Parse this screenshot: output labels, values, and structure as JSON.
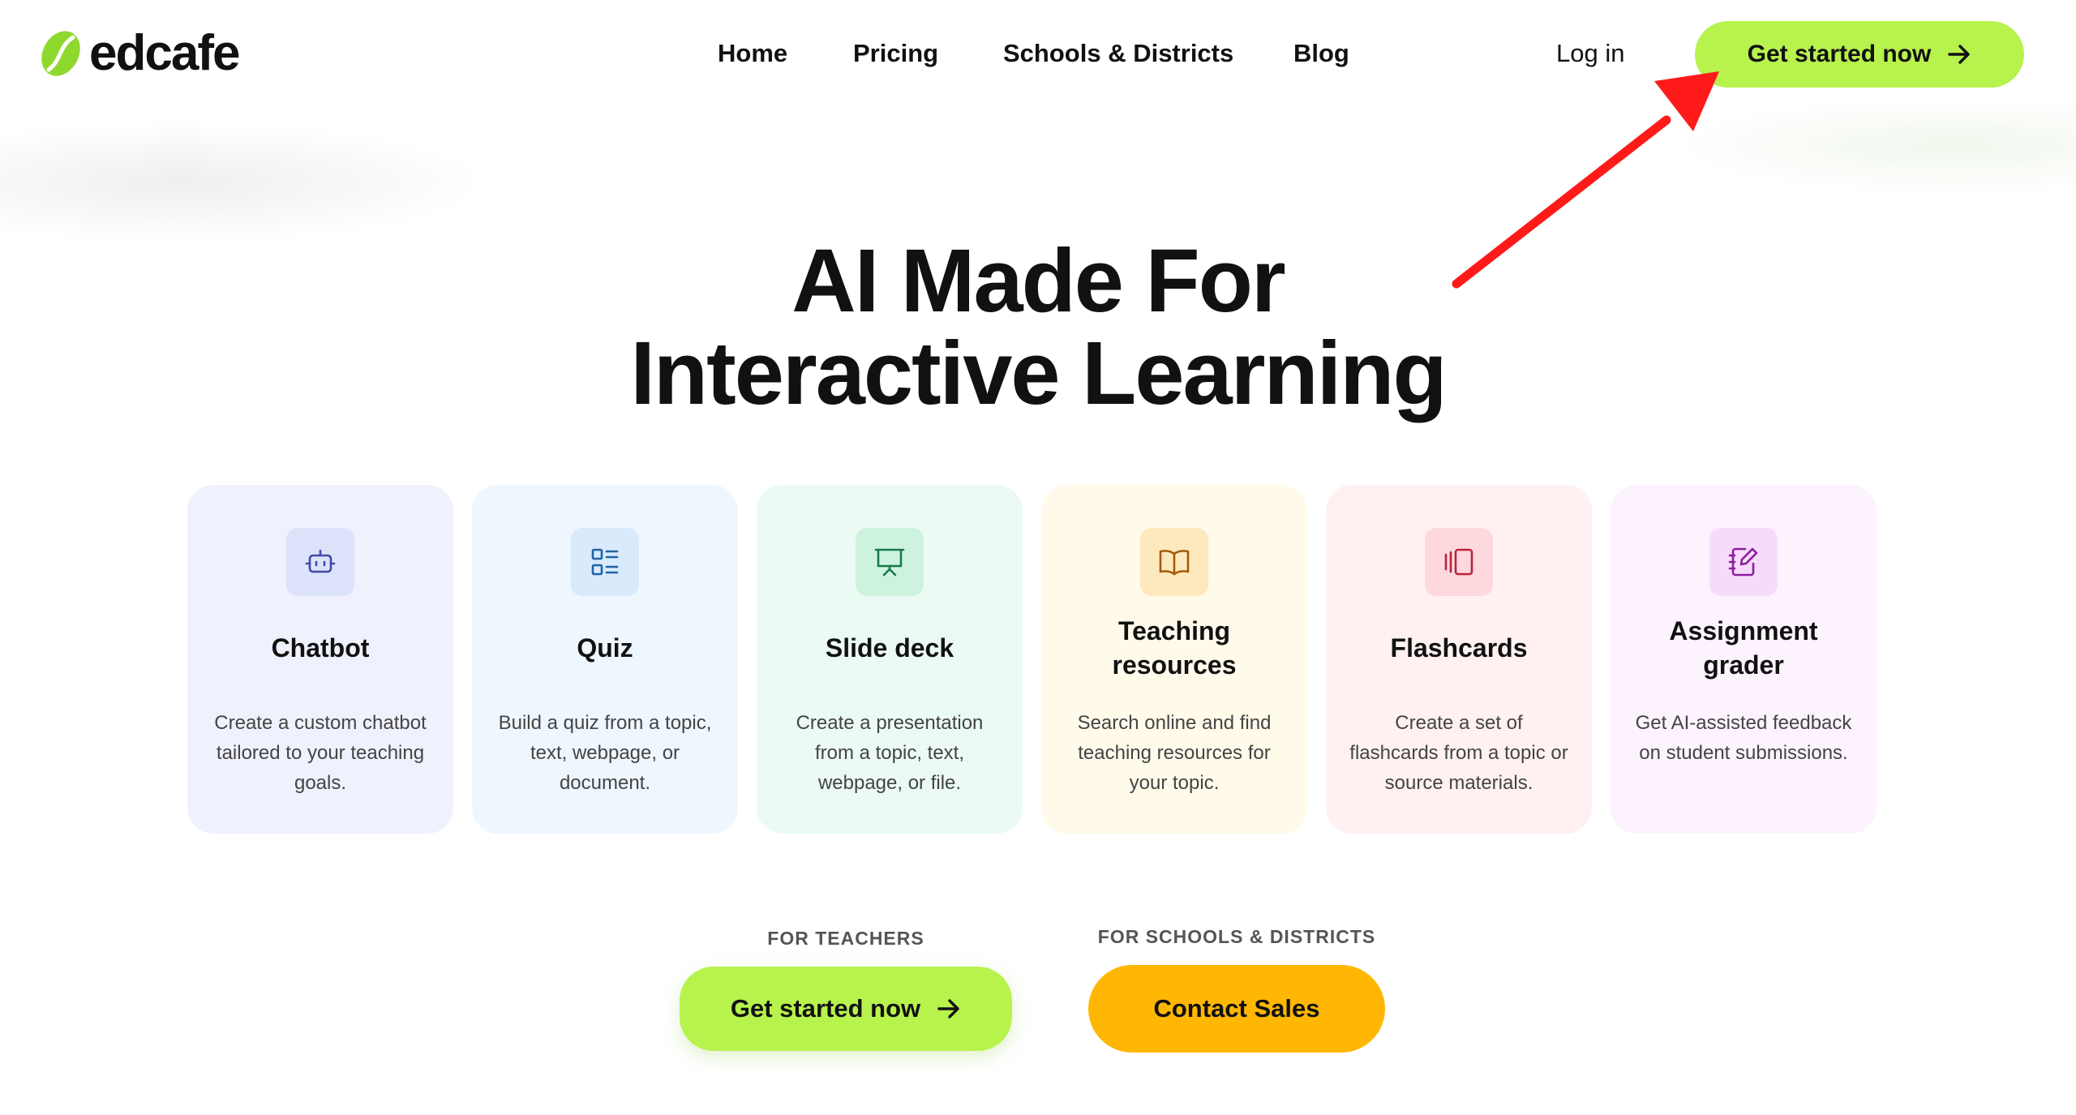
{
  "brand": {
    "name": "edcafe",
    "accent": "#b8f24d",
    "yellow": "#ffb703"
  },
  "nav": {
    "items": [
      {
        "label": "Home"
      },
      {
        "label": "Pricing"
      },
      {
        "label": "Schools & Districts"
      },
      {
        "label": "Blog"
      }
    ],
    "login": "Log in",
    "cta": "Get started now",
    "cta_icon": "arrow-right-icon"
  },
  "hero": {
    "line1": "AI Made For",
    "line2": "Interactive Learning"
  },
  "cards": [
    {
      "icon": "robot-icon",
      "title": "Chatbot",
      "desc": "Create a custom chatbot tailored to your teaching goals."
    },
    {
      "icon": "list-icon",
      "title": "Quiz",
      "desc": "Build a quiz from a topic, text, webpage, or document."
    },
    {
      "icon": "presentation-icon",
      "title": "Slide deck",
      "desc": "Create a presentation from a topic, text, webpage, or file."
    },
    {
      "icon": "book-icon",
      "title": "Teaching resources",
      "desc": "Search online and find teaching resources for your topic."
    },
    {
      "icon": "cards-icon",
      "title": "Flashcards",
      "desc": "Create a set of flashcards from a topic or source materials."
    },
    {
      "icon": "notebook-pen-icon",
      "title": "Assignment grader",
      "desc": "Get AI-assisted feedback on student submissions."
    }
  ],
  "cta": {
    "teachers_label": "FOR TEACHERS",
    "teachers_button": "Get started now",
    "schools_label": "FOR SCHOOLS & DISTRICTS",
    "schools_button": "Contact Sales"
  },
  "annotation": {
    "color": "#ff1a1a",
    "icon": "red-pointer-arrow"
  }
}
